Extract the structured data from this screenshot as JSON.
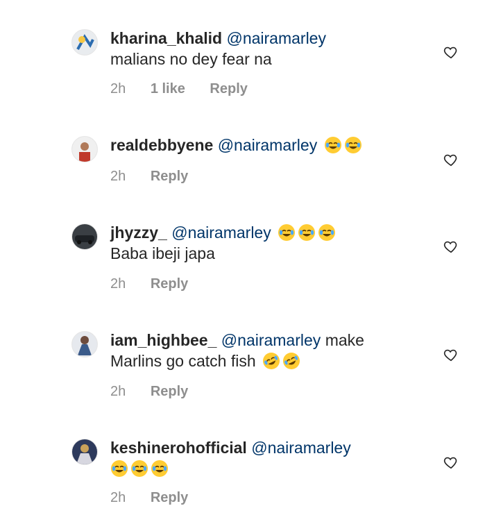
{
  "comments": [
    {
      "username": "kharina_khalid",
      "mention": "@nairamarley",
      "text_inline": "",
      "text_line2": "malians no dey fear na",
      "emojis": [],
      "time": "2h",
      "likes": "1 like",
      "reply": "Reply"
    },
    {
      "username": "realdebbyene",
      "mention": "@nairamarley",
      "text_inline": "",
      "text_line2": "",
      "emojis": [
        "face-with-tears-of-joy-icon",
        "face-with-tears-of-joy-icon"
      ],
      "time": "2h",
      "likes": "",
      "reply": "Reply"
    },
    {
      "username": "jhyzzy_",
      "mention": "@nairamarley",
      "text_inline": "",
      "text_line2": "Baba ibeji japa",
      "emojis": [
        "face-with-tears-of-joy-icon",
        "face-with-tears-of-joy-icon",
        "face-with-tears-of-joy-icon"
      ],
      "time": "2h",
      "likes": "",
      "reply": "Reply"
    },
    {
      "username": "iam_highbee_",
      "mention": "@nairamarley",
      "text_inline": "make",
      "text_line2": "Marlins go catch fish",
      "emojis": [
        "rolling-on-floor-laughing-icon",
        "rolling-on-floor-laughing-icon"
      ],
      "time": "2h",
      "likes": "",
      "reply": "Reply"
    },
    {
      "username": "keshinerohofficial",
      "mention": "@nairamarley",
      "text_inline": "",
      "text_line2": "",
      "emojis": [
        "face-with-tears-of-joy-icon",
        "face-with-tears-of-joy-icon",
        "face-with-tears-of-joy-icon"
      ],
      "time": "2h",
      "likes": "",
      "reply": "Reply"
    }
  ],
  "colors": {
    "username": "#262626",
    "mention": "#003569",
    "meta": "#8e8e8e",
    "emoji_face": "#ffcc33",
    "emoji_tears": "#4aa8ff"
  },
  "icons": {
    "like": "heart-outline-icon"
  }
}
